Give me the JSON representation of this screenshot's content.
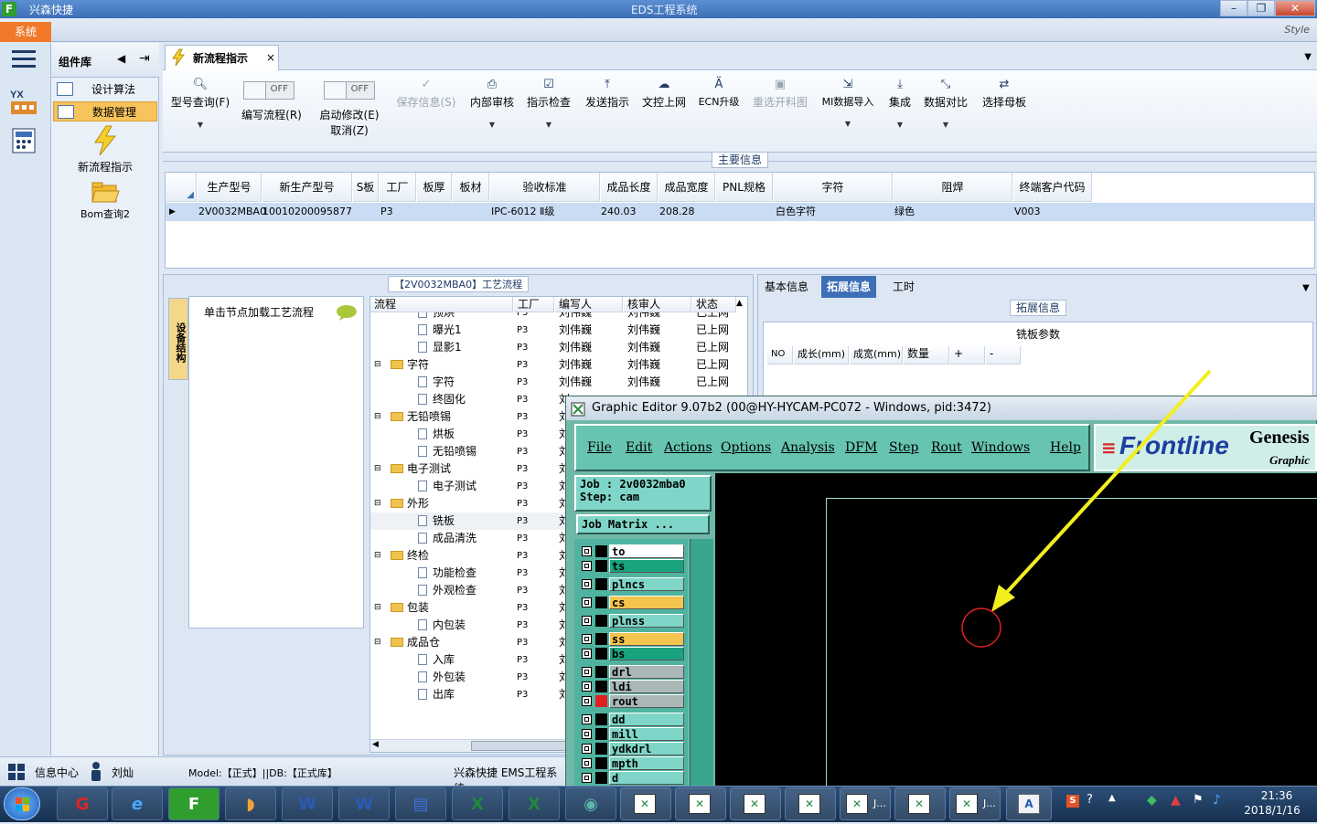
{
  "app": {
    "icon_letter": "F",
    "title": "兴森快捷",
    "window_title": "EDS工程系统",
    "system_menu": "系统",
    "style_label": "Style"
  },
  "components": {
    "header": "组件库",
    "items": [
      {
        "label": "设计算法",
        "selected": false
      },
      {
        "label": "数据管理",
        "selected": true
      }
    ],
    "tools": [
      {
        "label": "新流程指示",
        "icon": "lightning-icon"
      },
      {
        "label": "Bom查询2",
        "icon": "folder-open-icon"
      }
    ]
  },
  "tab": {
    "label": "新流程指示",
    "close": "×"
  },
  "toolbar": {
    "buttons": [
      {
        "label": "型号查询(F)",
        "icon": "search-icon",
        "disabled": false,
        "dropdown": true
      },
      {
        "label": "保存信息(S)",
        "icon": "check-icon",
        "disabled": true,
        "dropdown": false
      },
      {
        "label": "内部审核",
        "icon": "print-icon",
        "disabled": false,
        "dropdown": true
      },
      {
        "label": "指示检查",
        "icon": "checkbox-icon",
        "disabled": false,
        "dropdown": true
      },
      {
        "label": "发送指示",
        "icon": "upload-icon",
        "disabled": false,
        "dropdown": false
      },
      {
        "label": "文控上网",
        "icon": "cloud-upload-icon",
        "disabled": false,
        "dropdown": false
      },
      {
        "label": "ECN升级",
        "icon": "ecn-icon",
        "disabled": false,
        "dropdown": false
      },
      {
        "label": "重选开料图",
        "icon": "image-icon",
        "disabled": true,
        "dropdown": false
      },
      {
        "label": "MI数据导入",
        "icon": "import-icon",
        "disabled": false,
        "dropdown": true
      },
      {
        "label": "集成",
        "icon": "download-icon",
        "disabled": false,
        "dropdown": true
      },
      {
        "label": "数据对比",
        "icon": "compare-icon",
        "disabled": false,
        "dropdown": true
      },
      {
        "label": "选择母板",
        "icon": "shuffle-icon",
        "disabled": false,
        "dropdown": false
      }
    ],
    "toggle1": {
      "state": "OFF",
      "label": "编写流程(R)"
    },
    "toggle2": {
      "state": "OFF",
      "label1": "启动修改(E)",
      "label2": "取消(Z)"
    }
  },
  "main_info": {
    "title": "主要信息",
    "columns": [
      "生产型号",
      "新生产型号",
      "S板",
      "工厂",
      "板厚",
      "板材",
      "验收标准",
      "成品长度",
      "成品宽度",
      "PNL规格",
      "字符",
      "阻焊",
      "终端客户代码"
    ],
    "row": [
      "2V0032MBA0",
      "10010200095877",
      "",
      "P3",
      "",
      "",
      "IPC-6012 Ⅱ级",
      "240.03",
      "208.28",
      "",
      "白色字符",
      "绿色",
      "V003"
    ]
  },
  "process": {
    "title": "【2V0032MBA0】工艺流程",
    "vertical_tab": "设备结构",
    "node_hint": "单击节点加载工艺流程",
    "columns": [
      "流程",
      "工厂",
      "编写人",
      "核审人",
      "状态"
    ],
    "rows": [
      {
        "name": "预烘",
        "type": "doc",
        "level": 2,
        "factory": "P3",
        "writer": "刘伟巍",
        "reviewer": "刘伟巍",
        "status": "已上网"
      },
      {
        "name": "曝光1",
        "type": "doc",
        "level": 2,
        "factory": "P3",
        "writer": "刘伟巍",
        "reviewer": "刘伟巍",
        "status": "已上网"
      },
      {
        "name": "显影1",
        "type": "doc",
        "level": 2,
        "factory": "P3",
        "writer": "刘伟巍",
        "reviewer": "刘伟巍",
        "status": "已上网"
      },
      {
        "name": "字符",
        "type": "folder",
        "level": 1,
        "factory": "P3",
        "writer": "刘伟巍",
        "reviewer": "刘伟巍",
        "status": "已上网"
      },
      {
        "name": "字符",
        "type": "doc",
        "level": 2,
        "factory": "P3",
        "writer": "刘伟巍",
        "reviewer": "刘伟巍",
        "status": "已上网"
      },
      {
        "name": "终固化",
        "type": "doc",
        "level": 2,
        "factory": "P3",
        "writer": "刘",
        "reviewer": "",
        "status": ""
      },
      {
        "name": "无铅喷锡",
        "type": "folder",
        "level": 1,
        "factory": "P3",
        "writer": "刘",
        "reviewer": "",
        "status": ""
      },
      {
        "name": "烘板",
        "type": "doc",
        "level": 2,
        "factory": "P3",
        "writer": "刘",
        "reviewer": "",
        "status": ""
      },
      {
        "name": "无铅喷锡",
        "type": "doc",
        "level": 2,
        "factory": "P3",
        "writer": "刘",
        "reviewer": "",
        "status": ""
      },
      {
        "name": "电子测试",
        "type": "folder",
        "level": 1,
        "factory": "P3",
        "writer": "刘",
        "reviewer": "",
        "status": ""
      },
      {
        "name": "电子测试",
        "type": "doc",
        "level": 2,
        "factory": "P3",
        "writer": "刘",
        "reviewer": "",
        "status": ""
      },
      {
        "name": "外形",
        "type": "folder",
        "level": 1,
        "factory": "P3",
        "writer": "刘",
        "reviewer": "",
        "status": ""
      },
      {
        "name": "铣板",
        "type": "doc",
        "level": 2,
        "factory": "P3",
        "writer": "刘",
        "reviewer": "",
        "status": ""
      },
      {
        "name": "成品清洗",
        "type": "doc",
        "level": 2,
        "factory": "P3",
        "writer": "刘",
        "reviewer": "",
        "status": ""
      },
      {
        "name": "终检",
        "type": "folder",
        "level": 1,
        "factory": "P3",
        "writer": "刘",
        "reviewer": "",
        "status": ""
      },
      {
        "name": "功能检查",
        "type": "doc",
        "level": 2,
        "factory": "P3",
        "writer": "刘",
        "reviewer": "",
        "status": ""
      },
      {
        "name": "外观检查",
        "type": "doc",
        "level": 2,
        "factory": "P3",
        "writer": "刘",
        "reviewer": "",
        "status": ""
      },
      {
        "name": "包装",
        "type": "folder",
        "level": 1,
        "factory": "P3",
        "writer": "刘",
        "reviewer": "",
        "status": ""
      },
      {
        "name": "内包装",
        "type": "doc",
        "level": 2,
        "factory": "P3",
        "writer": "刘",
        "reviewer": "",
        "status": ""
      },
      {
        "name": "成品仓",
        "type": "folder",
        "level": 1,
        "factory": "P3",
        "writer": "刘",
        "reviewer": "",
        "status": ""
      },
      {
        "name": "入库",
        "type": "doc",
        "level": 2,
        "factory": "P3",
        "writer": "刘",
        "reviewer": "",
        "status": ""
      },
      {
        "name": "外包装",
        "type": "doc",
        "level": 2,
        "factory": "P3",
        "writer": "刘",
        "reviewer": "",
        "status": ""
      },
      {
        "name": "出库",
        "type": "doc",
        "level": 2,
        "factory": "P3",
        "writer": "刘",
        "reviewer": "",
        "status": ""
      }
    ]
  },
  "right_panel": {
    "tabs": [
      "基本信息",
      "拓展信息",
      "工时"
    ],
    "active_tab": "拓展信息",
    "group_title": "拓展信息",
    "sub_title": "铣板参数",
    "columns": [
      "NO",
      "成长(mm)",
      "成宽(mm)",
      "数量",
      "+",
      "-"
    ]
  },
  "statusbar": {
    "info_center": "信息中心",
    "user": "刘灿",
    "model_db": "Model:【正式】||DB:【正式库】",
    "system_name": "兴森快捷 EMS工程系统"
  },
  "graphic_editor": {
    "title": "Graphic Editor 9.07b2 (00@HY-HYCAM-PC072 - Windows, pid:3472)",
    "menu": [
      "File",
      "Edit",
      "Actions",
      "Options",
      "Analysis",
      "DFM",
      "Step",
      "Rout",
      "Windows",
      "Help"
    ],
    "logo_text": "Frontline",
    "logo_right": "Genesis",
    "logo_sub": "Graphic",
    "job": "Job : 2v0032mba0",
    "step": "Step: cam",
    "job_matrix": "Job Matrix ...",
    "layers": [
      {
        "name": "to",
        "color": "#ffffff"
      },
      {
        "name": "ts",
        "color": "#19a37f"
      },
      {
        "name": "plncs",
        "color": "#7fd6c8"
      },
      {
        "name": "cs",
        "color": "#f3c54f"
      },
      {
        "name": "plnss",
        "color": "#7fd6c8"
      },
      {
        "name": "ss",
        "color": "#f3c54f"
      },
      {
        "name": "bs",
        "color": "#19a37f"
      },
      {
        "name": "drl",
        "color": "#a9b8b6"
      },
      {
        "name": "ldi",
        "color": "#a9b8b6"
      },
      {
        "name": "rout",
        "color": "#a9b8b6"
      },
      {
        "name": "dd",
        "color": "#7fd6c8"
      },
      {
        "name": "mill",
        "color": "#7fd6c8"
      },
      {
        "name": "ydkdrl",
        "color": "#7fd6c8"
      },
      {
        "name": "mpth",
        "color": "#7fd6c8"
      },
      {
        "name": "d",
        "color": "#7fd6c8"
      }
    ]
  },
  "taskbar": {
    "clock_time": "21:36",
    "clock_date": "2018/1/16",
    "task_labels": [
      "J...",
      "J..."
    ]
  },
  "colors": {
    "accent": "#3d6fb6",
    "orange": "#f07a2a",
    "arrow": "#f3ee1f",
    "circle": "#e02020"
  }
}
